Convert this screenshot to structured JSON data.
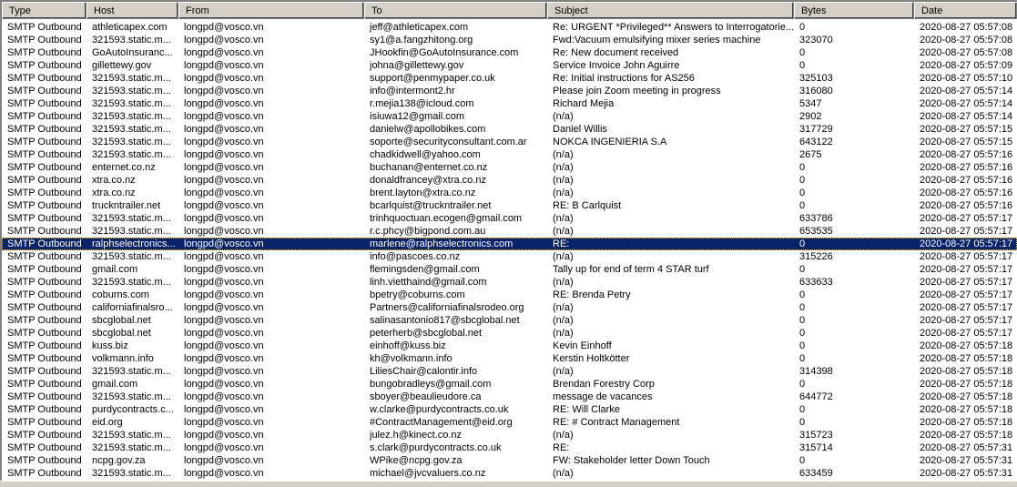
{
  "columns": [
    "Type",
    "Host",
    "From",
    "To",
    "Subject",
    "Bytes",
    "Date"
  ],
  "selected_row": 17,
  "colors": {
    "selection": "#0a246a",
    "header": "#d4d0c8"
  },
  "rows": [
    [
      "SMTP Outbound",
      "athleticapex.com",
      "longpd@vosco.vn",
      "jeff@athleticapex.com",
      "Re: URGENT *Privileged** Answers to Interrogatorie...",
      "0",
      "2020-08-27 05:57:08"
    ],
    [
      "SMTP Outbound",
      "321593.static.m...",
      "longpd@vosco.vn",
      "sy1@a.fangzhitong.org",
      "Fwd:Vacuum emulsifying mixer series machine",
      "323070",
      "2020-08-27 05:57:08"
    ],
    [
      "SMTP Outbound",
      "GoAutoInsuranc...",
      "longpd@vosco.vn",
      "JHookfin@GoAutoInsurance.com",
      "Re: New document received",
      "0",
      "2020-08-27 05:57:08"
    ],
    [
      "SMTP Outbound",
      "gillettewy.gov",
      "longpd@vosco.vn",
      "johna@gillettewy.gov",
      "Service Invoice John Aguirre",
      "0",
      "2020-08-27 05:57:09"
    ],
    [
      "SMTP Outbound",
      "321593.static.m...",
      "longpd@vosco.vn",
      "support@penmypaper.co.uk",
      "Re: Initial instructions for AS256",
      "325103",
      "2020-08-27 05:57:10"
    ],
    [
      "SMTP Outbound",
      "321593.static.m...",
      "longpd@vosco.vn",
      "info@intermont2.hr",
      "Please join Zoom meeting in progress",
      "316080",
      "2020-08-27 05:57:14"
    ],
    [
      "SMTP Outbound",
      "321593.static.m...",
      "longpd@vosco.vn",
      "r.mejia138@icloud.com",
      "Richard Mejia",
      "5347",
      "2020-08-27 05:57:14"
    ],
    [
      "SMTP Outbound",
      "321593.static.m...",
      "longpd@vosco.vn",
      "isiuwa12@gmail.com",
      "(n/a)",
      "2902",
      "2020-08-27 05:57:14"
    ],
    [
      "SMTP Outbound",
      "321593.static.m...",
      "longpd@vosco.vn",
      "danielw@apollobikes.com",
      "Daniel Willis",
      "317729",
      "2020-08-27 05:57:15"
    ],
    [
      "SMTP Outbound",
      "321593.static.m...",
      "longpd@vosco.vn",
      "soporte@securityconsultant.com.ar",
      "NOKCA INGENIERIA S.A",
      "643122",
      "2020-08-27 05:57:15"
    ],
    [
      "SMTP Outbound",
      "321593.static.m...",
      "longpd@vosco.vn",
      "chadkidwell@yahoo.com",
      "(n/a)",
      "2675",
      "2020-08-27 05:57:16"
    ],
    [
      "SMTP Outbound",
      "enternet.co.nz",
      "longpd@vosco.vn",
      "buchanan@enternet.co.nz",
      "(n/a)",
      "0",
      "2020-08-27 05:57:16"
    ],
    [
      "SMTP Outbound",
      "xtra.co.nz",
      "longpd@vosco.vn",
      "donaldfrancey@xtra.co.nz",
      "(n/a)",
      "0",
      "2020-08-27 05:57:16"
    ],
    [
      "SMTP Outbound",
      "xtra.co.nz",
      "longpd@vosco.vn",
      "brent.layton@xtra.co.nz",
      "(n/a)",
      "0",
      "2020-08-27 05:57:16"
    ],
    [
      "SMTP Outbound",
      "truckntrailer.net",
      "longpd@vosco.vn",
      "bcarlquist@truckntrailer.net",
      "RE: B Carlquist",
      "0",
      "2020-08-27 05:57:16"
    ],
    [
      "SMTP Outbound",
      "321593.static.m...",
      "longpd@vosco.vn",
      "trinhquoctuan.ecogen@gmail.com",
      "(n/a)",
      "633786",
      "2020-08-27 05:57:17"
    ],
    [
      "SMTP Outbound",
      "321593.static.m...",
      "longpd@vosco.vn",
      "r.c.phcy@bigpond.com.au",
      "(n/a)",
      "653535",
      "2020-08-27 05:57:17"
    ],
    [
      "SMTP Outbound",
      "ralphselectronics...",
      "longpd@vosco.vn",
      "marlene@ralphselectronics.com",
      "RE:",
      "0",
      "2020-08-27 05:57:17"
    ],
    [
      "SMTP Outbound",
      "321593.static.m...",
      "longpd@vosco.vn",
      "info@pascoes.co.nz",
      "(n/a)",
      "315226",
      "2020-08-27 05:57:17"
    ],
    [
      "SMTP Outbound",
      "gmail.com",
      "longpd@vosco.vn",
      "flemingsden@gmail.com",
      "Tally up for end of term 4 STAR turf",
      "0",
      "2020-08-27 05:57:17"
    ],
    [
      "SMTP Outbound",
      "321593.static.m...",
      "longpd@vosco.vn",
      "linh.vietthaind@gmail.com",
      "(n/a)",
      "633633",
      "2020-08-27 05:57:17"
    ],
    [
      "SMTP Outbound",
      "coburns.com",
      "longpd@vosco.vn",
      "bpetry@coburns.com",
      "RE: Brenda Petry",
      "0",
      "2020-08-27 05:57:17"
    ],
    [
      "SMTP Outbound",
      "californiafinalsro...",
      "longpd@vosco.vn",
      "Partners@californiafinalsrodeo.org",
      "(n/a)",
      "0",
      "2020-08-27 05:57:17"
    ],
    [
      "SMTP Outbound",
      "sbcglobal.net",
      "longpd@vosco.vn",
      "salinasantonio817@sbcglobal.net",
      "(n/a)",
      "0",
      "2020-08-27 05:57:17"
    ],
    [
      "SMTP Outbound",
      "sbcglobal.net",
      "longpd@vosco.vn",
      "peterherb@sbcglobal.net",
      "(n/a)",
      "0",
      "2020-08-27 05:57:17"
    ],
    [
      "SMTP Outbound",
      "kuss.biz",
      "longpd@vosco.vn",
      "einhoff@kuss.biz",
      "Kevin Einhoff",
      "0",
      "2020-08-27 05:57:18"
    ],
    [
      "SMTP Outbound",
      "volkmann.info",
      "longpd@vosco.vn",
      "kh@volkmann.info",
      "Kerstin Holtkötter",
      "0",
      "2020-08-27 05:57:18"
    ],
    [
      "SMTP Outbound",
      "321593.static.m...",
      "longpd@vosco.vn",
      "LiliesChair@calontir.info",
      "(n/a)",
      "314398",
      "2020-08-27 05:57:18"
    ],
    [
      "SMTP Outbound",
      "gmail.com",
      "longpd@vosco.vn",
      "bungobradleys@gmail.com",
      "Brendan Forestry Corp",
      "0",
      "2020-08-27 05:57:18"
    ],
    [
      "SMTP Outbound",
      "321593.static.m...",
      "longpd@vosco.vn",
      "sboyer@beaulieudore.ca",
      "message de vacances",
      "644772",
      "2020-08-27 05:57:18"
    ],
    [
      "SMTP Outbound",
      "purdycontracts.c...",
      "longpd@vosco.vn",
      "w.clarke@purdycontracts.co.uk",
      "RE: Will Clarke",
      "0",
      "2020-08-27 05:57:18"
    ],
    [
      "SMTP Outbound",
      "eid.org",
      "longpd@vosco.vn",
      "#ContractManagement@eid.org",
      "RE: # Contract Management",
      "0",
      "2020-08-27 05:57:18"
    ],
    [
      "SMTP Outbound",
      "321593.static.m...",
      "longpd@vosco.vn",
      "julez.h@kinect.co.nz",
      "(n/a)",
      "315723",
      "2020-08-27 05:57:18"
    ],
    [
      "SMTP Outbound",
      "321593.static.m...",
      "longpd@vosco.vn",
      "s.clark@purdycontracts.co.uk",
      "RE:",
      "315714",
      "2020-08-27 05:57:31"
    ],
    [
      "SMTP Outbound",
      "ncpg.gov.za",
      "longpd@vosco.vn",
      "WPike@ncpg.gov.za",
      "FW: Stakeholder letter Down Touch",
      "0",
      "2020-08-27 05:57:31"
    ],
    [
      "SMTP Outbound",
      "321593.static.m...",
      "longpd@vosco.vn",
      "michael@jvcvaluers.co.nz",
      "(n/a)",
      "633459",
      "2020-08-27 05:57:31"
    ]
  ]
}
